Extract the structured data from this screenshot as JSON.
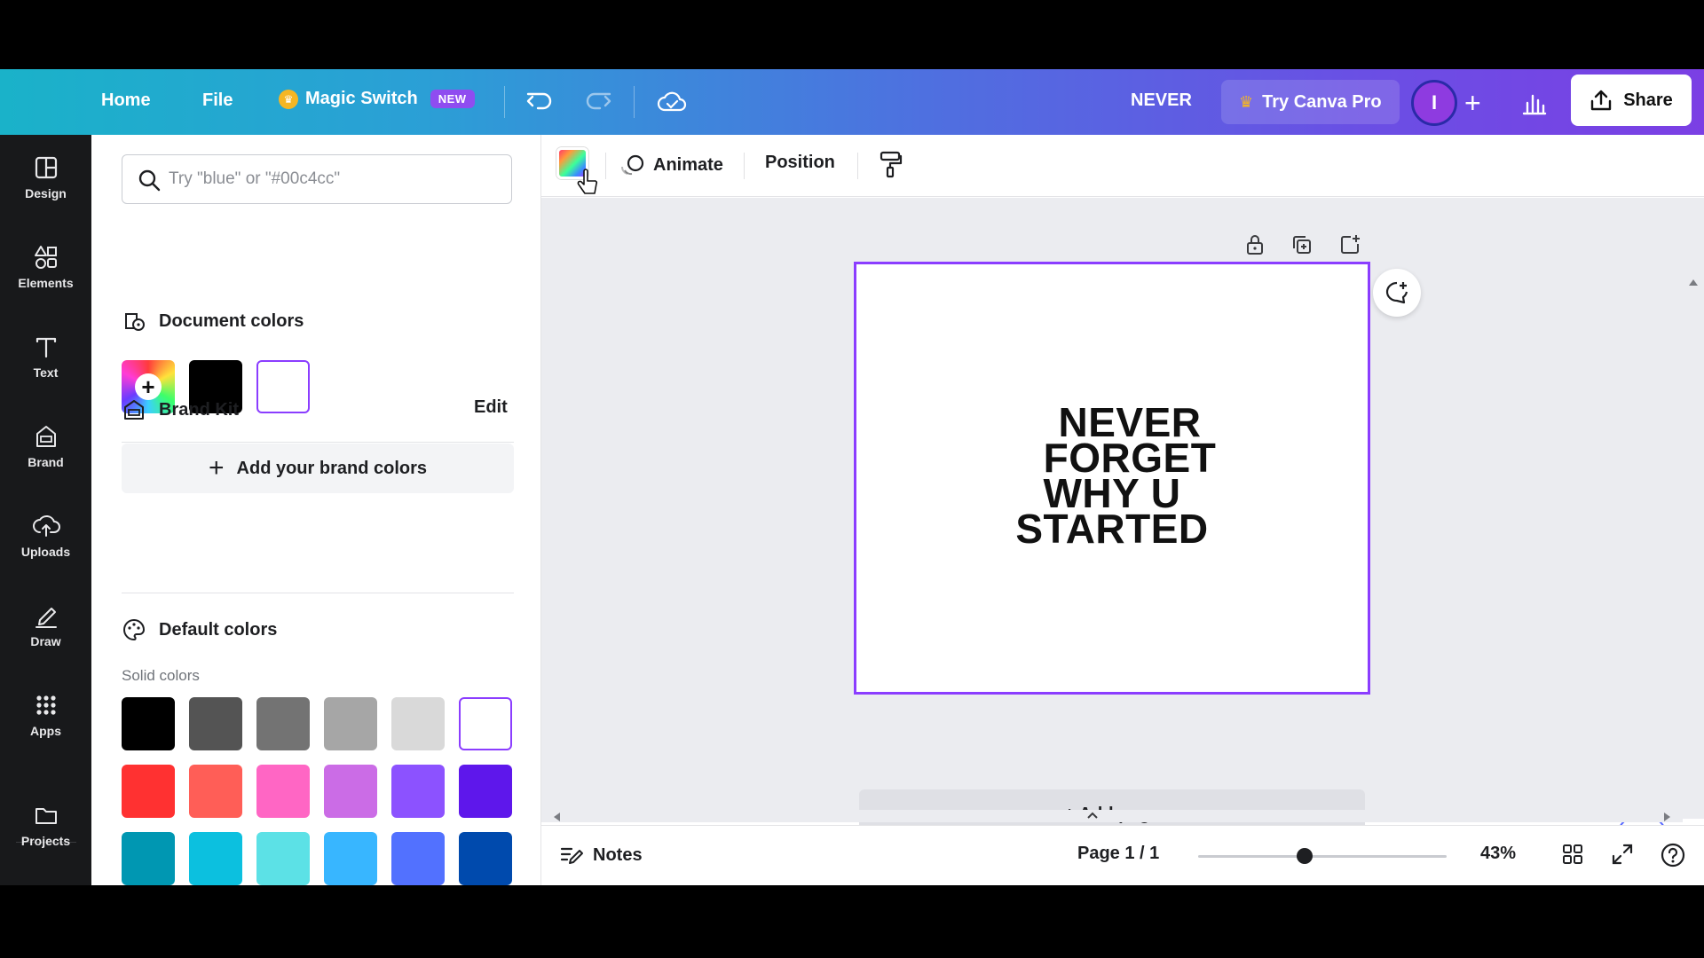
{
  "topbar": {
    "home": "Home",
    "file": "File",
    "magic_switch": "Magic Switch",
    "new_badge": "NEW",
    "doc_title": "NEVER",
    "try_pro": "Try Canva Pro",
    "avatar_initial": "I",
    "share": "Share"
  },
  "rail": {
    "items": [
      {
        "label": "Design",
        "icon": "layout-icon"
      },
      {
        "label": "Elements",
        "icon": "shapes-icon"
      },
      {
        "label": "Text",
        "icon": "text-icon"
      },
      {
        "label": "Brand",
        "icon": "brand-icon"
      },
      {
        "label": "Uploads",
        "icon": "cloud-upload-icon"
      },
      {
        "label": "Draw",
        "icon": "pen-icon"
      },
      {
        "label": "Apps",
        "icon": "grid-icon"
      },
      {
        "label": "Projects",
        "icon": "folder-icon"
      }
    ]
  },
  "panel": {
    "search_placeholder": "Try \"blue\" or \"#00c4cc\"",
    "document_colors": "Document colors",
    "brand_kit": "Brand Kit",
    "edit": "Edit",
    "add_brand_colors": "Add your brand colors",
    "default_colors": "Default colors",
    "solid_colors": "Solid colors",
    "doc_swatches": [
      "#000000",
      "#ffffff"
    ],
    "solid_rows": [
      [
        "#000000",
        "#545454",
        "#737373",
        "#a6a6a6",
        "#d9d9d9",
        "#ffffff"
      ],
      [
        "#ff3131",
        "#ff5e57",
        "#ff66c4",
        "#cb6ce6",
        "#8c52ff",
        "#5e17eb"
      ],
      [
        "#0097b2",
        "#0cc0df",
        "#5ce1e6",
        "#38b6ff",
        "#5271ff",
        "#004aad"
      ],
      [
        "#00bf63",
        "#7ed957",
        "#c1ff72",
        "#ffde59",
        "#ffbd59",
        "#ff914d"
      ]
    ]
  },
  "ctx": {
    "animate": "Animate",
    "position": "Position"
  },
  "canvas": {
    "lines": [
      "NEVER",
      "FORGET",
      "WHY U",
      "STARTED"
    ],
    "add_page": "+ Add page"
  },
  "bottom": {
    "notes": "Notes",
    "page_indicator": "Page 1 / 1",
    "zoom": "43%",
    "zoom_level": 0.43
  },
  "colors": {
    "accent": "#8b3dff",
    "rail_bg": "#18191b",
    "canvas_bg": "#ebecf0"
  }
}
